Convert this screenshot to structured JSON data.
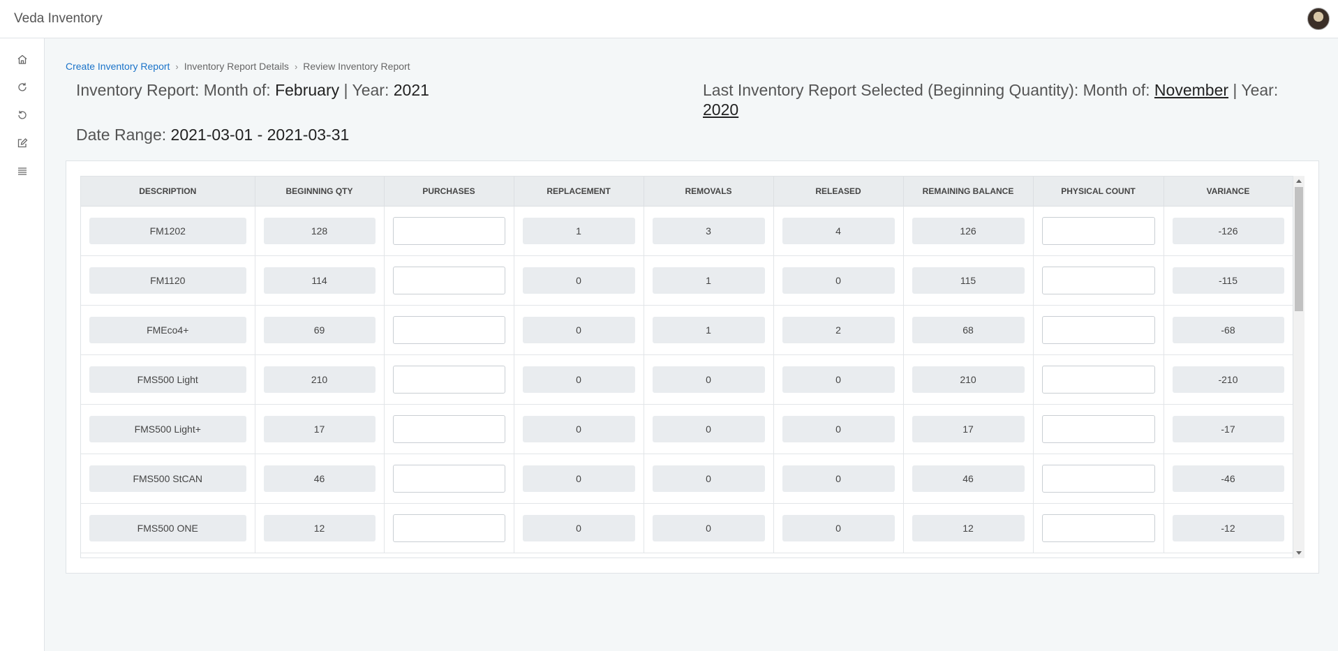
{
  "app": {
    "title": "Veda Inventory"
  },
  "sidebar": {
    "items": [
      {
        "icon": "home-icon"
      },
      {
        "icon": "refresh-icon"
      },
      {
        "icon": "undo-icon"
      },
      {
        "icon": "edit-icon"
      },
      {
        "icon": "list-icon"
      }
    ]
  },
  "breadcrumb": {
    "items": [
      "Create Inventory Report",
      "Inventory Report Details",
      "Review Inventory Report"
    ],
    "separator": "›"
  },
  "report": {
    "label": "Inventory Report: Month of: ",
    "month": "February",
    "year_label": " | Year: ",
    "year": "2021",
    "date_range_label": "Date Range: ",
    "date_range": "2021-03-01 - 2021-03-31"
  },
  "last_report": {
    "label": "Last Inventory Report Selected (Beginning Quantity): Month of: ",
    "month": "November",
    "year_label": " | Year: ",
    "year": "2020"
  },
  "table": {
    "columns": [
      "DESCRIPTION",
      "BEGINNING QTY",
      "PURCHASES",
      "REPLACEMENT",
      "REMOVALS",
      "RELEASED",
      "REMAINING BALANCE",
      "PHYSICAL COUNT",
      "VARIANCE"
    ],
    "rows": [
      {
        "description": "FM1202",
        "beginning_qty": "128",
        "purchases": "",
        "replacement": "1",
        "removals": "3",
        "released": "4",
        "remaining_balance": "126",
        "physical_count": "",
        "variance": "-126"
      },
      {
        "description": "FM1120",
        "beginning_qty": "114",
        "purchases": "",
        "replacement": "0",
        "removals": "1",
        "released": "0",
        "remaining_balance": "115",
        "physical_count": "",
        "variance": "-115"
      },
      {
        "description": "FMEco4+",
        "beginning_qty": "69",
        "purchases": "",
        "replacement": "0",
        "removals": "1",
        "released": "2",
        "remaining_balance": "68",
        "physical_count": "",
        "variance": "-68"
      },
      {
        "description": "FMS500 Light",
        "beginning_qty": "210",
        "purchases": "",
        "replacement": "0",
        "removals": "0",
        "released": "0",
        "remaining_balance": "210",
        "physical_count": "",
        "variance": "-210"
      },
      {
        "description": "FMS500 Light+",
        "beginning_qty": "17",
        "purchases": "",
        "replacement": "0",
        "removals": "0",
        "released": "0",
        "remaining_balance": "17",
        "physical_count": "",
        "variance": "-17"
      },
      {
        "description": "FMS500 StCAN",
        "beginning_qty": "46",
        "purchases": "",
        "replacement": "0",
        "removals": "0",
        "released": "0",
        "remaining_balance": "46",
        "physical_count": "",
        "variance": "-46"
      },
      {
        "description": "FMS500 ONE",
        "beginning_qty": "12",
        "purchases": "",
        "replacement": "0",
        "removals": "0",
        "released": "0",
        "remaining_balance": "12",
        "physical_count": "",
        "variance": "-12"
      }
    ]
  }
}
